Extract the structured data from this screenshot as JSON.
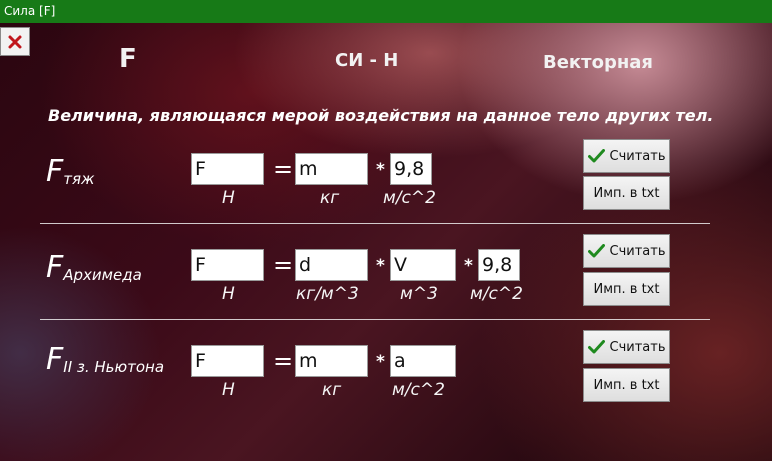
{
  "window": {
    "title": "Сила [F]"
  },
  "header": {
    "symbol": "F",
    "unit": "СИ - Н",
    "type": "Векторная"
  },
  "description": "Величина, являющаяся мерой воздействия на данное тело других тел.",
  "icons": {
    "close": "close-x-icon",
    "check": "checkmark-icon",
    "close_color": "#c0161c",
    "check_color": "#1f8a1f"
  },
  "formulas": [
    {
      "name_main": "F",
      "name_sub": "тяж",
      "result_value": "F",
      "result_unit": "Н",
      "equals": "=",
      "terms": [
        {
          "value": "m",
          "unit": "кг"
        },
        {
          "value": "9,8",
          "unit": "м/с^2"
        }
      ],
      "operator": "*",
      "calc_label": "Считать",
      "export_label": "Имп. в txt"
    },
    {
      "name_main": "F",
      "name_sub": "Архимеда",
      "result_value": "F",
      "result_unit": "Н",
      "equals": "=",
      "terms": [
        {
          "value": "d",
          "unit": "кг/м^3"
        },
        {
          "value": "V",
          "unit": "м^3"
        },
        {
          "value": "9,8",
          "unit": "м/с^2"
        }
      ],
      "operator": "*",
      "calc_label": "Считать",
      "export_label": "Имп. в txt"
    },
    {
      "name_main": "F",
      "name_sub": "II з. Ньютона",
      "result_value": "F",
      "result_unit": "Н",
      "equals": "=",
      "terms": [
        {
          "value": "m",
          "unit": "кг"
        },
        {
          "value": "a",
          "unit": "м/с^2"
        }
      ],
      "operator": "*",
      "calc_label": "Считать",
      "export_label": "Имп. в txt"
    }
  ]
}
